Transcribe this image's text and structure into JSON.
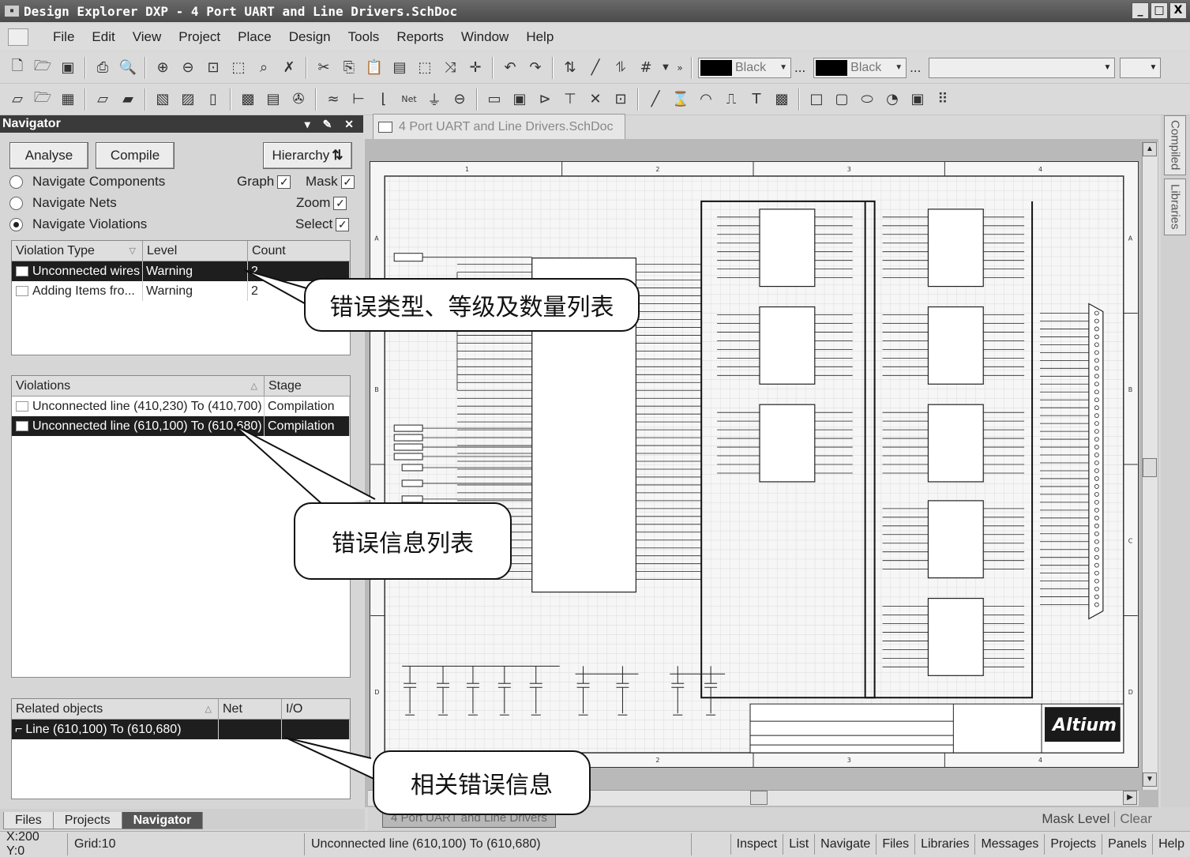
{
  "window": {
    "app_icon": "dxp-icon",
    "title": "Design Explorer DXP - 4 Port UART and Line Drivers.SchDoc",
    "controls": [
      "_",
      "□",
      "X"
    ]
  },
  "menu": [
    "File",
    "Edit",
    "View",
    "Project",
    "Place",
    "Design",
    "Tools",
    "Reports",
    "Window",
    "Help"
  ],
  "toolbar": {
    "color1": "Black",
    "color2": "Black",
    "ellipsis": "...",
    "color_swatch": "#000000",
    "icons_row1": [
      "new-doc-icon",
      "open-icon",
      "save-icon",
      "print-icon",
      "print-preview-icon",
      "zoom-in-icon",
      "zoom-out-icon",
      "zoom-fit-icon",
      "zoom-area-icon",
      "zoom-select-icon",
      "clear-filter-icon",
      "cut-icon",
      "copy-icon",
      "paste-icon",
      "rubber-stamp-icon",
      "select-area-icon",
      "move-icon",
      "cross-icon",
      "undo-icon",
      "redo-icon",
      "hierarchy-icon",
      "edit-icon",
      "browse-icon",
      "grid-icon"
    ],
    "icons_row2": [
      "new-sch-icon",
      "open-sch-icon",
      "new-lib-icon",
      "pcb-icon",
      "pcb-lib-icon",
      "project-icon",
      "copy-proj-icon",
      "doc-icon",
      "comp-icon",
      "lib-edit-icon",
      "tool-icon",
      "bus-icon",
      "entry-icon",
      "wire-icon",
      "net-icon",
      "gnd-icon",
      "port-icon",
      "part-icon",
      "sheet-icon",
      "sheet-entry-icon",
      "power-icon",
      "no-erc-icon",
      "probe-icon",
      "line-icon",
      "arc-icon",
      "bezier-icon",
      "polyline-icon",
      "text-icon",
      "image-icon",
      "rect-icon",
      "round-rect-icon",
      "ellipse-icon",
      "pie-icon",
      "graphic-icon",
      "array-icon"
    ]
  },
  "navigator": {
    "title": "Navigator",
    "analyse": "Analyse",
    "compile": "Compile",
    "hierarchy": "Hierarchy",
    "options": [
      {
        "label": "Navigate Components",
        "selected": false
      },
      {
        "label": "Navigate Nets",
        "selected": false
      },
      {
        "label": "Navigate Violations",
        "selected": true
      }
    ],
    "checks": [
      {
        "label": "Graph",
        "checked": true
      },
      {
        "label": "Mask",
        "checked": true
      },
      {
        "label": "Zoom",
        "checked": true
      },
      {
        "label": "Select",
        "checked": true
      }
    ],
    "violation_types": {
      "columns": [
        "Violation Type",
        "Level",
        "Count"
      ],
      "rows": [
        {
          "type": "Unconnected wires",
          "level": "Warning",
          "count": "2",
          "selected": true
        },
        {
          "type": "Adding Items fro...",
          "level": "Warning",
          "count": "2",
          "selected": false
        }
      ]
    },
    "violations": {
      "columns": [
        "Violations",
        "Stage"
      ],
      "rows": [
        {
          "text": "Unconnected line (410,230) To (410,700)",
          "stage": "Compilation",
          "selected": false
        },
        {
          "text": "Unconnected line (610,100) To (610,680)",
          "stage": "Compilation",
          "selected": true
        }
      ]
    },
    "related": {
      "columns": [
        "Related objects",
        "Net",
        "I/O"
      ],
      "rows": [
        {
          "text": "Line (610,100) To (610,680)",
          "net": "",
          "io": "",
          "selected": true
        }
      ]
    }
  },
  "panel_tabs": [
    "Files",
    "Projects",
    "Navigator"
  ],
  "document": {
    "tab": "4 Port UART and Line Drivers.SchDoc",
    "bottom_tab": "4 Port UART and Line Drivers",
    "mask_level": "Mask Level",
    "clear": "Clear",
    "logo": "Altium",
    "col_labels": [
      "1",
      "2",
      "3",
      "4"
    ],
    "row_labels": [
      "A",
      "B",
      "C",
      "D"
    ]
  },
  "right_tabs": [
    "Compiled",
    "Libraries"
  ],
  "status": {
    "coords": "X:200 Y:0",
    "grid": "Grid:10",
    "message": "Unconnected line (610,100) To (610,680)",
    "buttons": [
      "Inspect",
      "List",
      "Navigate",
      "Files",
      "Libraries",
      "Messages",
      "Projects",
      "Panels",
      "Help"
    ]
  },
  "callouts": {
    "violation_types": "错误类型、等级及数量列表",
    "violations": "错误信息列表",
    "related": "相关错误信息"
  }
}
